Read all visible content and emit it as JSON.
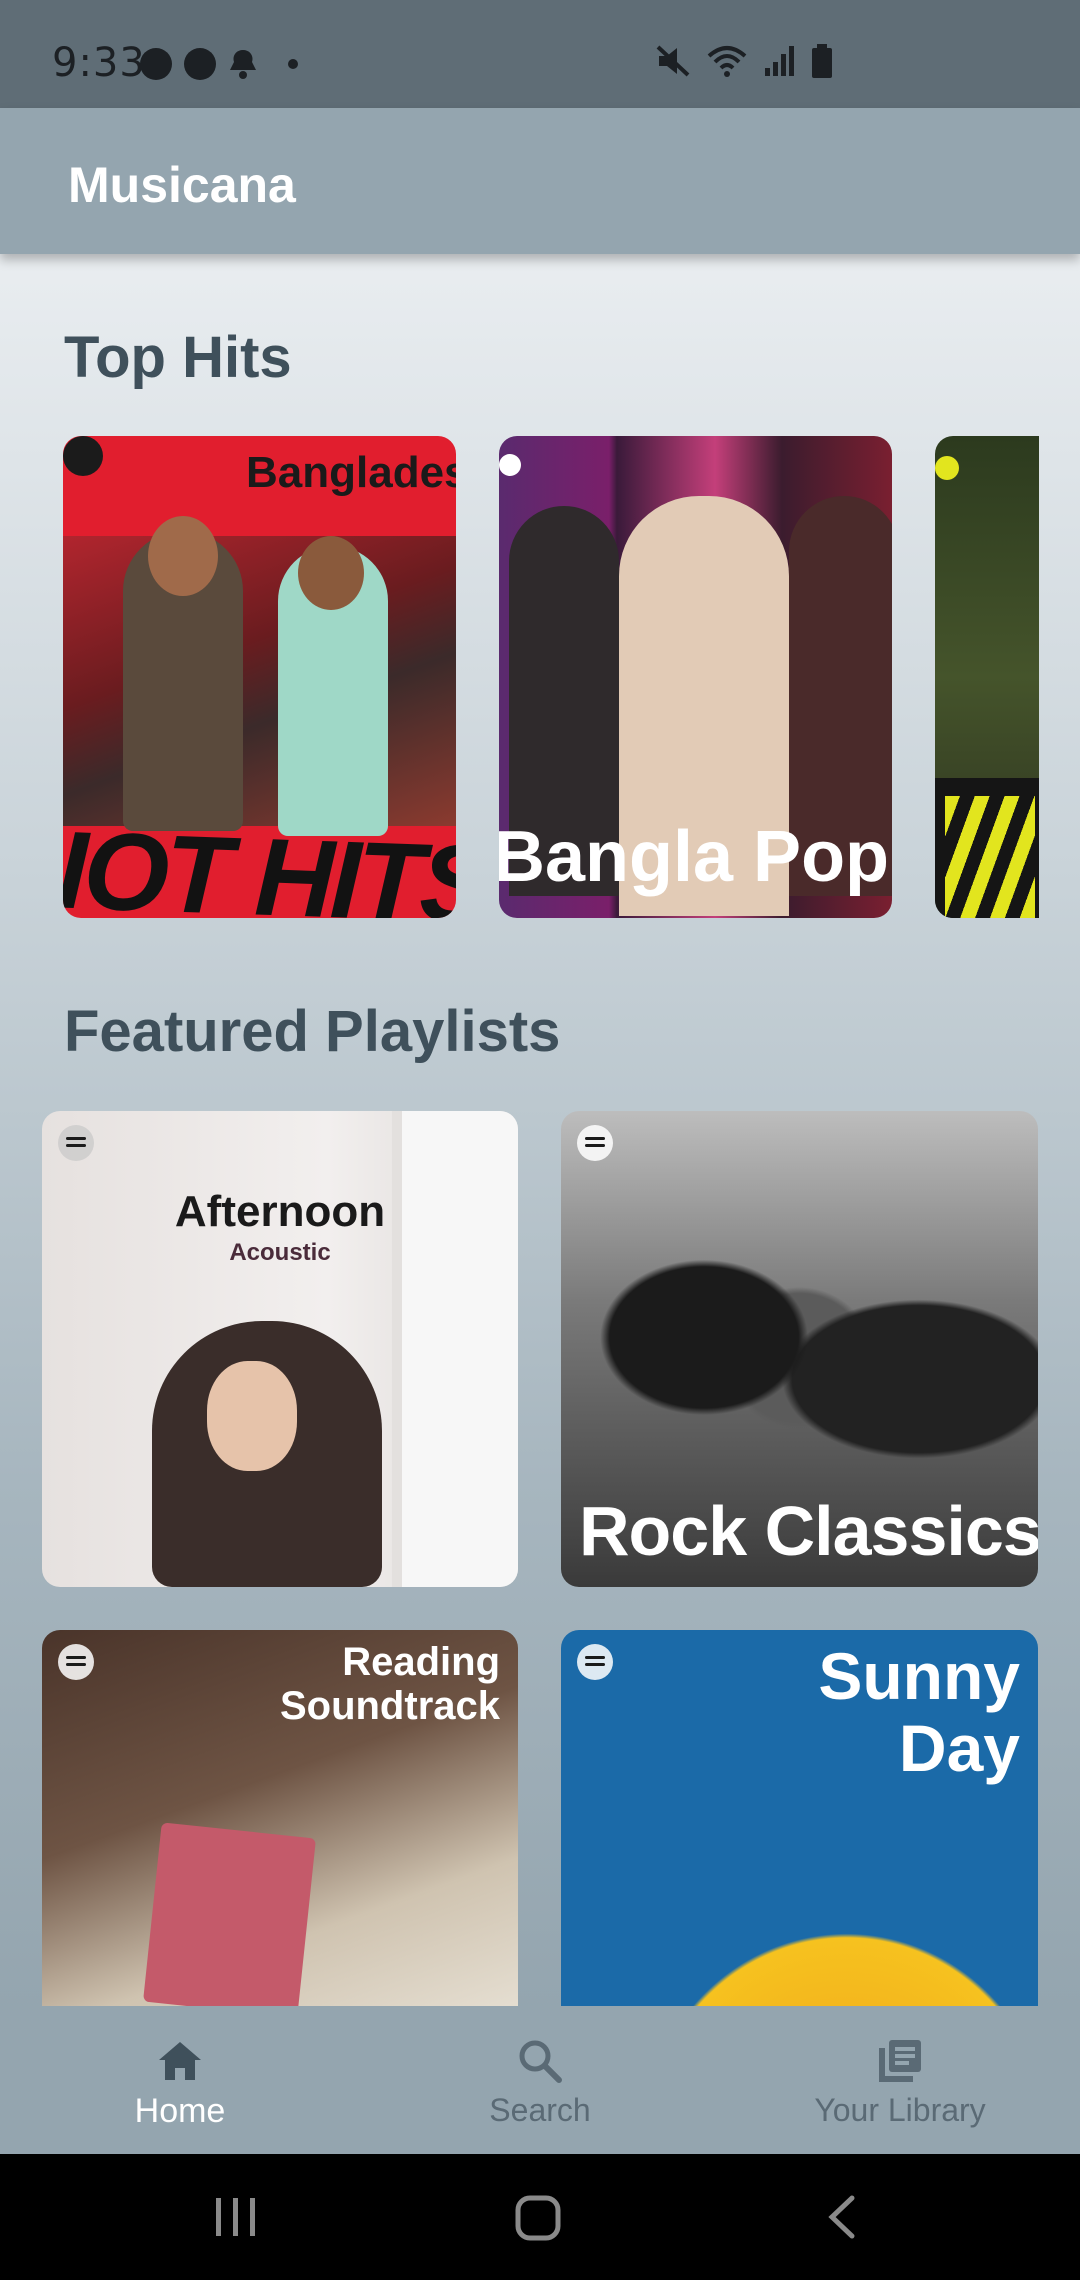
{
  "status_bar": {
    "time": "9:33",
    "icons": [
      "messenger-icon",
      "messenger-icon",
      "notification-icon",
      "dot",
      "mute-icon",
      "wifi-icon",
      "signal-icon",
      "battery-icon"
    ]
  },
  "app_bar": {
    "title": "Musicana"
  },
  "sections": {
    "top_hits": {
      "title": "Top Hits",
      "cards": [
        {
          "label_top": "Banglades",
          "label_bottom": "IOT HITS"
        },
        {
          "label": "Bangla Pop"
        },
        {
          "label": ""
        }
      ]
    },
    "featured": {
      "title": "Featured Playlists",
      "cards": [
        {
          "title": "Afternoon",
          "subtitle": "Acoustic"
        },
        {
          "title": "Rock Classics"
        },
        {
          "title_line1": "Reading",
          "title_line2": "Soundtrack"
        },
        {
          "title_line1": "Sunny",
          "title_line2": "Day"
        }
      ]
    }
  },
  "bottom_nav": {
    "items": [
      {
        "label": "Home",
        "icon": "home-icon",
        "active": true
      },
      {
        "label": "Search",
        "icon": "search-icon",
        "active": false
      },
      {
        "label": "Your Library",
        "icon": "library-icon",
        "active": false
      }
    ]
  },
  "colors": {
    "app_bar": "#94a5af",
    "status_bar": "#5f6d76",
    "section_title": "#3f505b",
    "nav_active": "#ffffff",
    "nav_inactive": "#5a6a75"
  }
}
